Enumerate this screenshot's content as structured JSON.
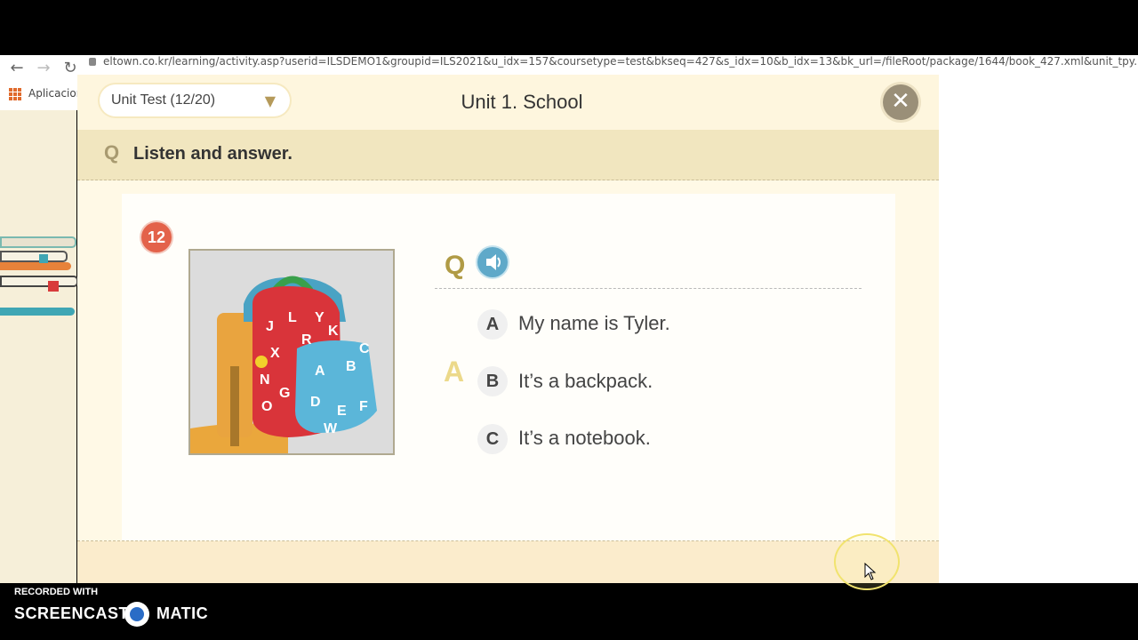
{
  "browser": {
    "url": "eltown.co.kr/learning/activity.asp?userid=ILSDEMO1&groupid=ILS2021&u_idx=157&coursetype=test&bkseq=427&s_idx=10&b_idx=13&bk_url=/fileRoot/package/1644/book_427.xml&unit_tpy...",
    "bookmark_label": "Aplicacion"
  },
  "header": {
    "unit_selector": "Unit Test (12/20)",
    "title": "Unit 1. School"
  },
  "instruction": {
    "q_label": "Q",
    "text": "Listen and answer."
  },
  "question": {
    "number": "12",
    "q_label": "Q",
    "answer_label": "A",
    "options": [
      {
        "letter": "A",
        "text": "My name is Tyler."
      },
      {
        "letter": "B",
        "text": "It’s a backpack."
      },
      {
        "letter": "C",
        "text": "It’s a notebook."
      }
    ]
  },
  "watermark": {
    "line1": "RECORDED WITH",
    "word1": "SCREENCAST",
    "word2": "MATIC"
  },
  "colors": {
    "accent_red": "#e3624a",
    "audio_blue": "#5fa9c9",
    "panel_bg": "#fff9e6"
  }
}
